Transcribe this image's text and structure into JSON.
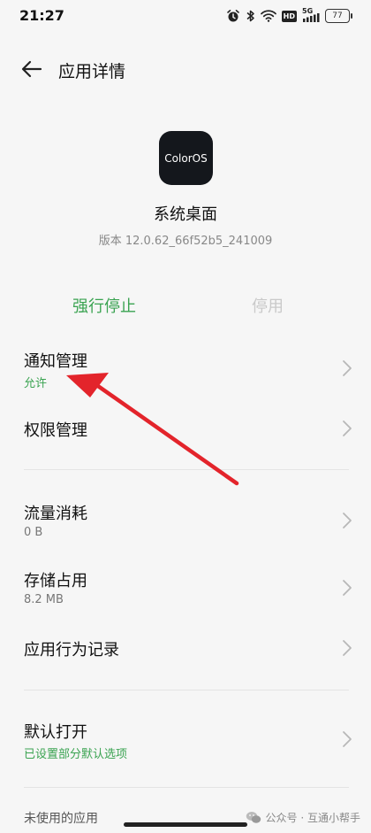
{
  "status_bar": {
    "time": "21:27",
    "icons": [
      "alarm-icon",
      "bluetooth-icon",
      "wifi-icon",
      "hd-icon",
      "signal-5g-icon",
      "battery-icon"
    ],
    "hd_label": "HD",
    "network_label": "5G",
    "battery_level": "77"
  },
  "header": {
    "title": "应用详情",
    "back_icon": "back-arrow-icon"
  },
  "app": {
    "icon_text": "ColorOS",
    "name": "系统桌面",
    "version": "版本 12.0.62_66f52b5_241009"
  },
  "actions": {
    "force_stop": "强行停止",
    "disable": "停用"
  },
  "rows": {
    "notification": {
      "title": "通知管理",
      "subtitle": "允许"
    },
    "permission": {
      "title": "权限管理"
    },
    "data_usage": {
      "title": "流量消耗",
      "subtitle": "0 B"
    },
    "storage": {
      "title": "存储占用",
      "subtitle": "8.2 MB"
    },
    "behavior": {
      "title": "应用行为记录"
    },
    "default_open": {
      "title": "默认打开",
      "subtitle": "已设置部分默认选项"
    }
  },
  "sections": {
    "unused_apps": "未使用的应用"
  },
  "watermark": {
    "text": "公众号 · 互通小帮手"
  },
  "colors": {
    "accent_green": "#3aa351",
    "disabled_gray": "#c9c9c9",
    "annotation_red": "#e3242b",
    "background": "#f6f6f6"
  }
}
